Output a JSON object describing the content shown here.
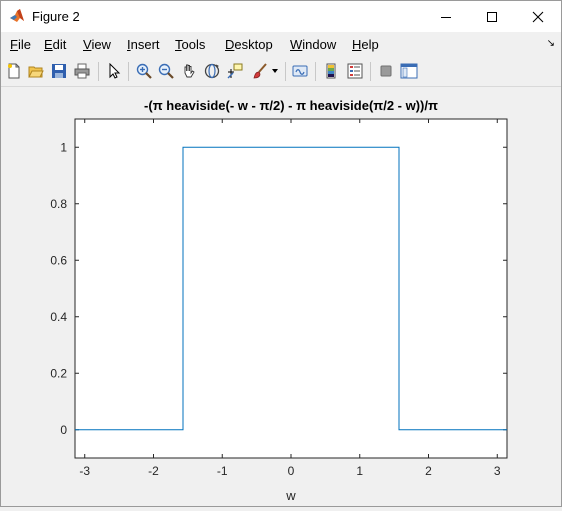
{
  "window": {
    "title": "Figure 2"
  },
  "menubar": {
    "items": [
      {
        "key": "F",
        "rest": "ile"
      },
      {
        "key": "E",
        "rest": "dit"
      },
      {
        "key": "V",
        "rest": "iew"
      },
      {
        "key": "I",
        "rest": "nsert"
      },
      {
        "key": "T",
        "rest": "ools"
      },
      {
        "key": "D",
        "rest": "esktop"
      },
      {
        "key": "W",
        "rest": "indow"
      },
      {
        "key": "H",
        "rest": "elp"
      }
    ]
  },
  "toolbar": {
    "icons": [
      "new-figure-icon",
      "open-file-icon",
      "save-icon",
      "print-icon",
      "pointer-icon",
      "zoom-in-icon",
      "zoom-out-icon",
      "pan-icon",
      "rotate-3d-icon",
      "data-cursor-icon",
      "brush-icon",
      "link-plot-icon",
      "colorbar-icon",
      "legend-icon",
      "hide-plot-tools-icon",
      "show-plot-tools-icon"
    ]
  },
  "accent_colors": {
    "line": "#0072bd"
  },
  "chart_data": {
    "type": "line",
    "title": "-(π heaviside(- w - π/2) - π heaviside(π/2 - w))/π",
    "xlabel": "w",
    "ylabel": "",
    "xlim": [
      -3.14159,
      3.14159
    ],
    "ylim": [
      -0.1,
      1.1
    ],
    "xticks": [
      -3,
      -2,
      -1,
      0,
      1,
      2,
      3
    ],
    "yticks": [
      0,
      0.2,
      0.4,
      0.6,
      0.8,
      1
    ],
    "xtick_labels": [
      "-3",
      "-2",
      "-1",
      "0",
      "1",
      "2",
      "3"
    ],
    "ytick_labels": [
      "0",
      "0.2",
      "0.4",
      "0.6",
      "0.8",
      "1"
    ],
    "grid": false,
    "series": [
      {
        "x": [
          -3.14159,
          -1.5708,
          -1.5708,
          1.5708,
          1.5708,
          3.14159
        ],
        "y": [
          0,
          0,
          1,
          1,
          0,
          0
        ]
      }
    ]
  }
}
